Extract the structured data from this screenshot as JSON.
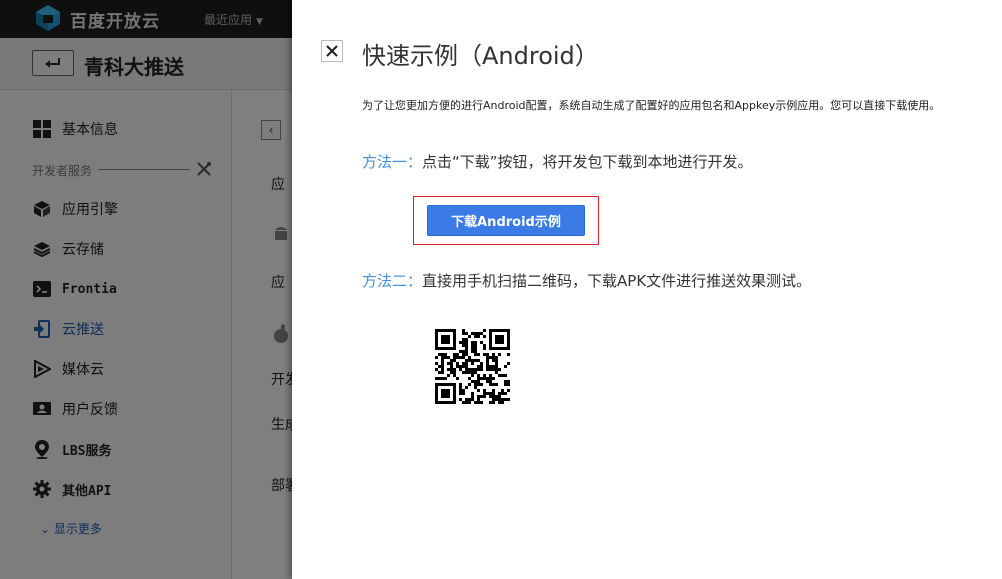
{
  "topbar": {
    "brand": "百度开放云",
    "recent_apps": "最近应用"
  },
  "app": {
    "title": "青科大推送"
  },
  "sidebar": {
    "section_label": "开发者服务",
    "items": [
      {
        "label": "基本信息",
        "icon": "grid-icon"
      },
      {
        "label": "应用引擎",
        "icon": "cube-icon"
      },
      {
        "label": "云存储",
        "icon": "layers-icon"
      },
      {
        "label": "Frontia",
        "icon": "terminal-icon"
      },
      {
        "label": "云推送",
        "icon": "push-icon"
      },
      {
        "label": "媒体云",
        "icon": "play-icon"
      },
      {
        "label": "用户反馈",
        "icon": "feedback-icon"
      },
      {
        "label": "LBS服务",
        "icon": "location-icon"
      },
      {
        "label": "其他API",
        "icon": "gear-icon"
      }
    ],
    "show_more": "显示更多"
  },
  "content": {
    "fragments": [
      "应",
      "应",
      "开发",
      "生成",
      "部署"
    ]
  },
  "dialog": {
    "title": "快速示例（Android）",
    "intro": "为了让您更加方便的进行Android配置，系统自动生成了配置好的应用包名和Appkey示例应用。您可以直接下载使用。",
    "method1_tag": "方法一：",
    "method1_text": "点击“下载”按钮，将开发包下载到本地进行开发。",
    "download_button": "下载Android示例",
    "method2_tag": "方法二：",
    "method2_text": "直接用手机扫描二维码，下载APK文件进行推送效果测试。"
  },
  "colors": {
    "accent": "#3a7be5",
    "method_tag": "#4a90d9",
    "highlight_frame": "#d9252a",
    "active_nav": "#1b5fb3"
  }
}
